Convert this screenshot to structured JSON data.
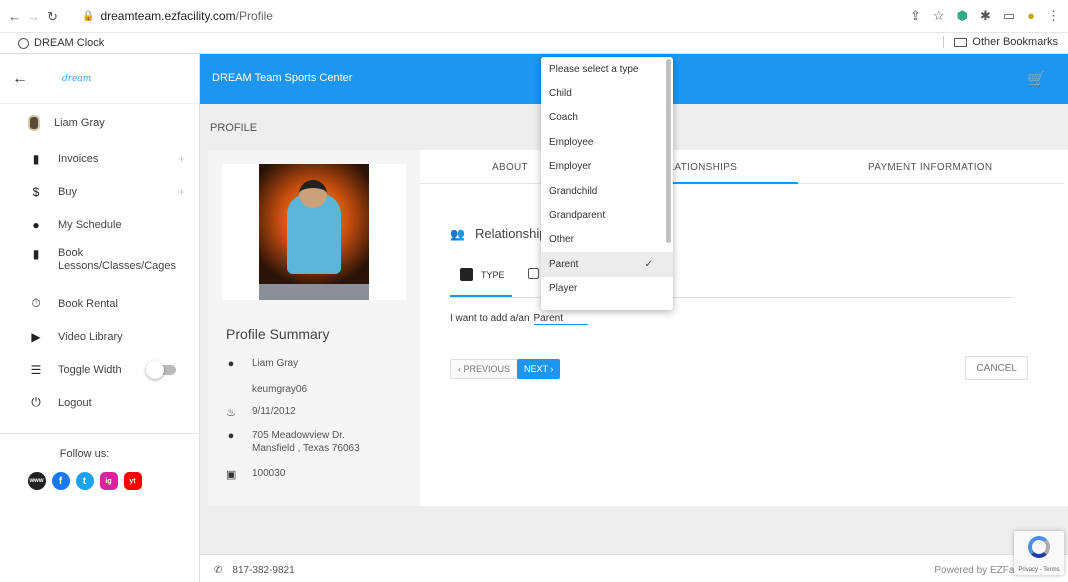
{
  "browser": {
    "url_domain": "dreamteam.ezfacility.com",
    "url_path": "/Profile",
    "bookmark_left": "DREAM Clock",
    "bookmark_right": "Other Bookmarks"
  },
  "sidebar": {
    "logo": "dream",
    "user_name": "Liam Gray",
    "items": [
      {
        "label": "Invoices",
        "icon": "document-icon"
      },
      {
        "label": "Buy",
        "icon": "dollar-icon"
      },
      {
        "label": "My Schedule",
        "icon": "person-icon"
      },
      {
        "label": "Book Lessons/Classes/Cages",
        "icon": "book-icon"
      },
      {
        "label": "Book Rental",
        "icon": "stopwatch-icon"
      },
      {
        "label": "Video Library",
        "icon": "video-icon"
      },
      {
        "label": "Toggle Width",
        "icon": "toggle-width-icon"
      },
      {
        "label": "Logout",
        "icon": "power-icon"
      }
    ],
    "follow_us": "Follow us:",
    "socials": [
      "www",
      "f",
      "t",
      "ig",
      "yt"
    ]
  },
  "header": {
    "title": "DREAM Team Sports Center"
  },
  "page": {
    "title": "PROFILE"
  },
  "profile_summary": {
    "heading": "Profile Summary",
    "name": "Liam Gray",
    "username": "keumgray06",
    "birthdate": "9/11/2012",
    "address_line1": "705 Meadowview Dr.",
    "address_line2": "Mansfield , Texas 76063",
    "id": "100030"
  },
  "tabs": {
    "about": "ABOUT",
    "relationships": "RELATIONSHIPS",
    "payment": "PAYMENT INFORMATION"
  },
  "relationships": {
    "heading": "Relationships",
    "subtab_type": "TYPE",
    "add_label": "I want to add a/an",
    "add_value": "Parent",
    "prev": "‹ PREVIOUS",
    "next": "NEXT ›",
    "cancel": "CANCEL"
  },
  "dropdown": {
    "options": [
      "Please select a type",
      "Child",
      "Coach",
      "Employee",
      "Employer",
      "Grandchild",
      "Grandparent",
      "Other",
      "Parent",
      "Player"
    ],
    "selected": "Parent"
  },
  "footer": {
    "phone": "817-382-9821",
    "powered": "Powered by EZFacility ®"
  },
  "recaptcha": {
    "text": "Privacy - Terms"
  },
  "colors": {
    "accent": "#1e96f0"
  }
}
